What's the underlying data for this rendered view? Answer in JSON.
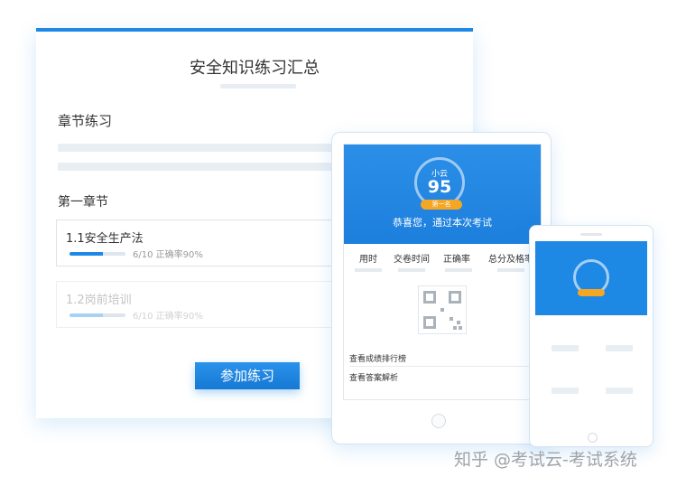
{
  "desktop": {
    "title": "安全知识练习汇总",
    "section": "章节练习",
    "chapter": "第一章节",
    "lessons": [
      {
        "name": "1.1安全生产法",
        "stats": "6/10  正确率90%",
        "progress": 0.6
      },
      {
        "name": "1.2岗前培训",
        "stats": "6/10  正确率90%",
        "progress": 0.6
      }
    ],
    "join_button": "参加练习"
  },
  "tablet": {
    "user": "小云",
    "score": "95",
    "rank": "第一名",
    "congrats": "恭喜您，通过本次考试",
    "stat_headers": [
      "用时",
      "交卷时间",
      "正确率",
      "总分及格率"
    ],
    "links": [
      "查看成绩排行榜",
      "查看答案解析"
    ]
  },
  "watermark": "知乎 @考试云-考试系统",
  "colors": {
    "accent": "#1e88e5",
    "badge": "#f5a623"
  },
  "icons": [
    "qr-code-icon",
    "home-button-icon"
  ]
}
